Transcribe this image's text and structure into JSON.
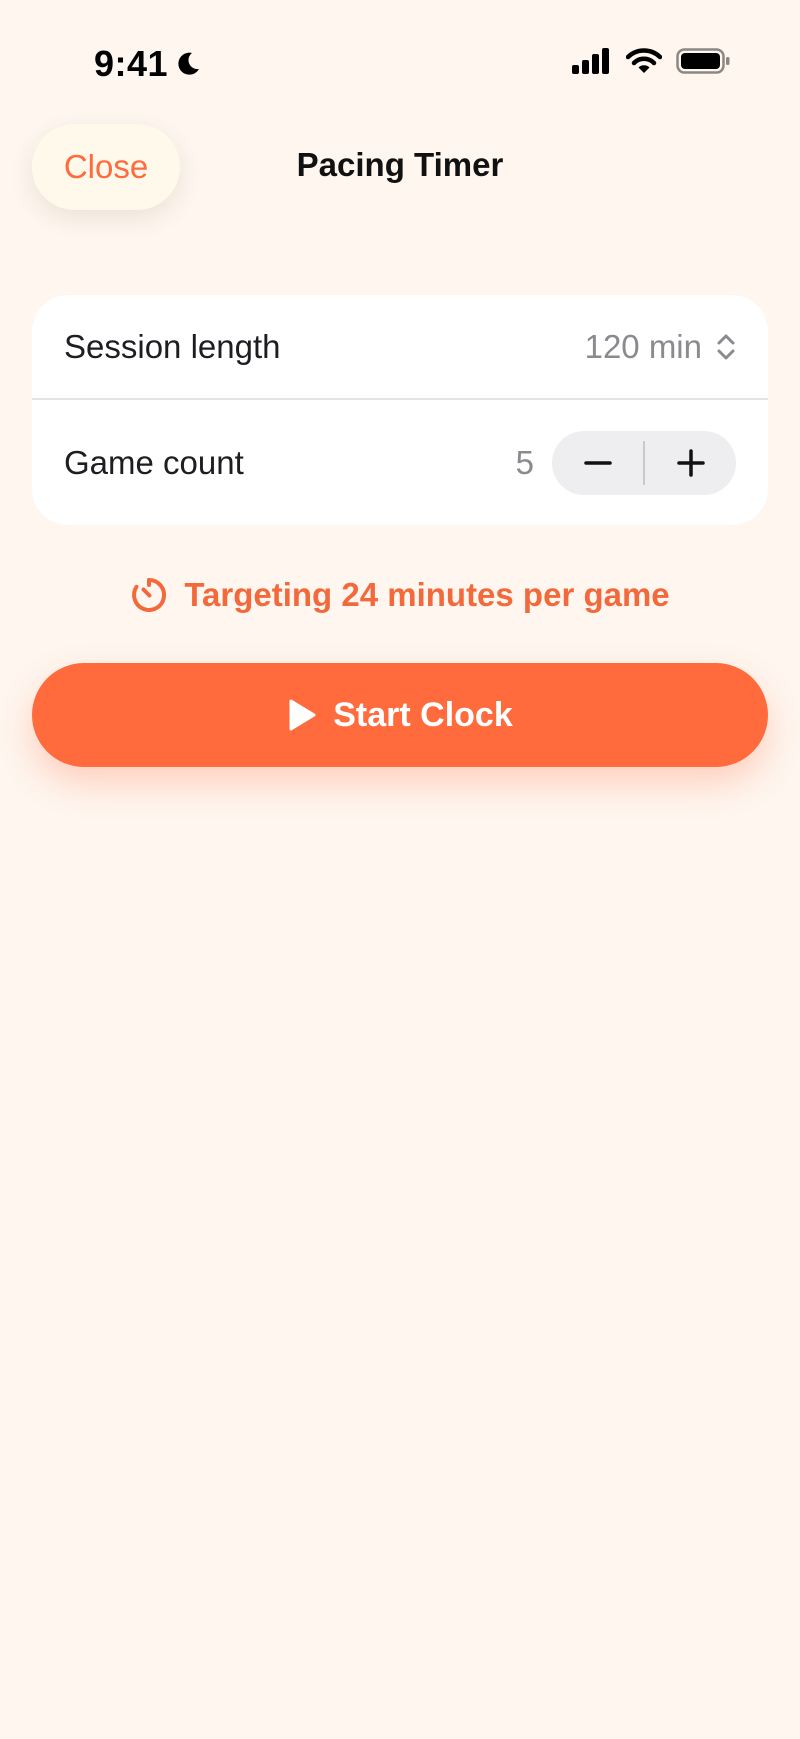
{
  "status_bar": {
    "time": "9:41",
    "icons": [
      "moon-icon",
      "cellular-signal-icon",
      "wifi-icon",
      "battery-icon"
    ]
  },
  "nav": {
    "close_label": "Close",
    "title": "Pacing Timer"
  },
  "settings": {
    "session_length": {
      "label": "Session length",
      "value": "120 min"
    },
    "game_count": {
      "label": "Game count",
      "value": "5"
    }
  },
  "target_hint": {
    "text": "Targeting 24 minutes per game",
    "icon": "timer-icon"
  },
  "start_button": {
    "label": "Start Clock",
    "icon": "play-icon"
  },
  "colors": {
    "background": "#FEF6EF",
    "accent": "#FF6B3D",
    "accent_text": "#F26A3B",
    "card": "#FFFFFF",
    "secondary_text": "#8A8A8F"
  }
}
